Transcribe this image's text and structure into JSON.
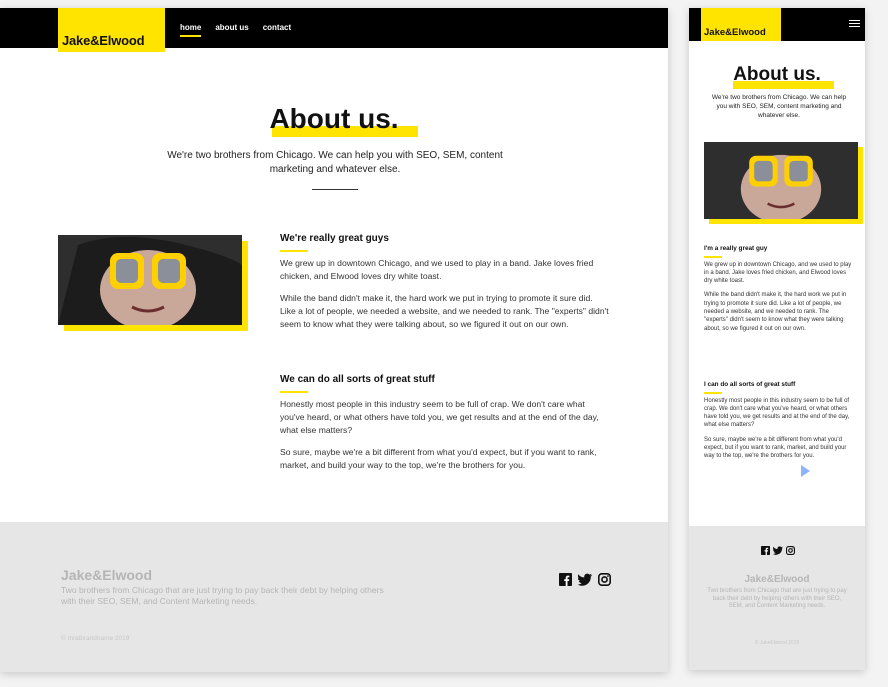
{
  "desktop": {
    "nav": {
      "logo": "Jake&Elwood",
      "links": [
        "home",
        "about us",
        "contact"
      ]
    },
    "hero": {
      "title": "About us.",
      "subtitle": "We're two brothers from Chicago. We can help you with SEO, SEM, content marketing and whatever else."
    },
    "sections": [
      {
        "heading": "We're really great guys",
        "p1": "We grew up in downtown Chicago, and we used to play in a band. Jake loves fried chicken, and Elwood loves dry white toast.",
        "p2": "While the band didn't make it, the hard work we put in trying to promote it sure did. Like a lot of people, we needed a website, and we needed to rank. The \"experts\" didn't seem to know what they were talking about, so we figured it out on our own."
      },
      {
        "heading": "We can do all sorts of great stuff",
        "p1": "Honestly most people in this industry seem to be full of crap. We don't care what you've heard, or what others have told you, we get results and at the end of the day, what else matters?",
        "p2": "So sure, maybe we're a bit different from what you'd expect, but if you want to rank, market, and build your way to the top, we're the brothers for you."
      }
    ],
    "footer": {
      "brand": "Jake&Elwood",
      "description": "Two brothers from Chicago that are just trying to pay back their debt by helping others with their SEO, SEM, and Content Marketing needs.",
      "copyright": "© mralbrandname 2019",
      "social_icons": [
        "facebook-icon",
        "twitter-icon",
        "instagram-icon"
      ]
    }
  },
  "mobile": {
    "nav": {
      "logo": "Jake&Elwood"
    },
    "hero": {
      "title": "About us.",
      "subtitle": "We're two brothers from Chicago. We can help you with SEO, SEM, content marketing and whatever else."
    },
    "sections": [
      {
        "heading": "I'm a really great guy",
        "p1": "We grew up in downtown Chicago, and we used to play in a band. Jake loves fried chicken, and Elwood loves dry white toast.",
        "p2": "While the band didn't make it, the hard work we put in trying to promote it sure did. Like a lot of people, we needed a website, and we needed to rank. The \"experts\" didn't seem to know what they were talking about, so we figured it out on our own."
      },
      {
        "heading": "I can do all sorts of great stuff",
        "p1": "Honestly most people in this industry seem to be full of crap. We don't care what you've heard, or what others have told you, we get results and at the end of the day, what else matters?",
        "p2": "So sure, maybe we're a bit different from what you'd expect, but if you want to rank, market, and build your way to the top, we're the brothers for you."
      }
    ],
    "footer": {
      "brand": "Jake&Elwood",
      "description": "Two brothers from Chicago that are just trying to pay back their debt by helping others with their SEO, SEM, and Content Marketing needs.",
      "copyright": "© JakeElwood 2019"
    }
  },
  "colors": {
    "accent": "#ffe400",
    "nav_bg": "#000000",
    "footer_bg": "#e6e6e6"
  }
}
